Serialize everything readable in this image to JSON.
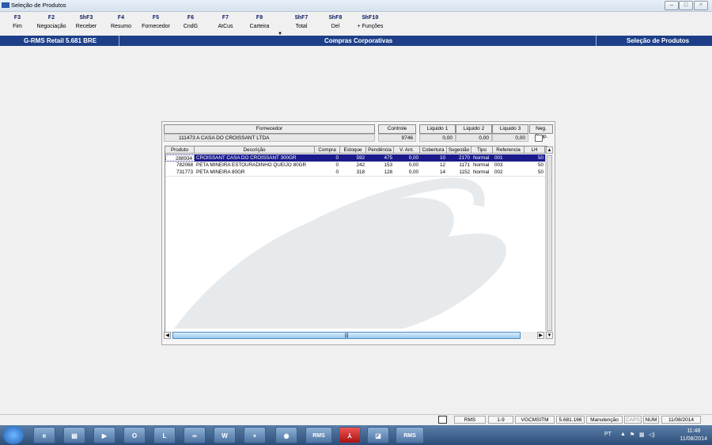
{
  "window": {
    "title": "Seleção de Produtos"
  },
  "fkeys": [
    {
      "key": "F3",
      "label": "Fim"
    },
    {
      "key": "F2",
      "label": "Negociação"
    },
    {
      "key": "ShF3",
      "label": "Receber"
    },
    {
      "key": "F4",
      "label": "Resumo"
    },
    {
      "key": "F5",
      "label": "Fornecedor"
    },
    {
      "key": "F6",
      "label": "CndG"
    },
    {
      "key": "F7",
      "label": "AtCus"
    },
    {
      "key": "F9",
      "label": "Carteira"
    },
    {
      "key": "ShF7",
      "label": "Total"
    },
    {
      "key": "ShF8",
      "label": "Del"
    },
    {
      "key": "ShF10",
      "label": "+ Funções"
    }
  ],
  "header": {
    "left": "G-RMS Retail 5.681 BRE",
    "center": "Compras Corporativas",
    "right": "Seleção de Produtos"
  },
  "supplier": {
    "fornecedor_label": "Fornecedor",
    "fornecedor_value": "111473  A CASA DO CROISSANT LTDA",
    "controle_label": "Controle",
    "controle_value": "9746",
    "liquido1_label": "Liquido 1",
    "liquido1_value": "0,00",
    "liquido2_label": "Liquido 2",
    "liquido2_value": "0,00",
    "liquido3_label": "Liquido 3",
    "liquido3_value": "0,00",
    "neg_simp_label": "Neg. Simp."
  },
  "grid": {
    "columns": [
      "Produto",
      "Descrição",
      "Compra",
      "Estoque",
      "Pendência",
      "V. Ant.",
      "Cobertura",
      "Sugestão",
      "Tipo",
      "Referencia",
      "LH"
    ],
    "rows": [
      [
        "288934",
        "CROISSANT CASA DO CROISSANT 300GR",
        "0",
        "592",
        "475",
        "0,00",
        "10",
        "2170",
        "Normal",
        "001",
        "50"
      ],
      [
        "782068",
        "PETA MINEIRA ESTOURADINHO QUEIJO 80GR",
        "0",
        "242",
        "153",
        "0,00",
        "12",
        "1171",
        "Normal",
        "003",
        "50"
      ],
      [
        "731773",
        "PETA MINEIRA 80GR",
        "0",
        "318",
        "128",
        "0,00",
        "14",
        "1152",
        "Normal",
        "002",
        "50"
      ]
    ]
  },
  "statusbar": {
    "app": "RMS",
    "range": "1-9",
    "user": "VGCMSITM",
    "version": "5.681.166",
    "mode": "Manutenção",
    "caps": "CAPS",
    "num": "NUM",
    "date": "11/08/2014"
  },
  "taskbar": {
    "lang": "PT",
    "time": "11:48",
    "date": "11/08/2014",
    "app_labels": [
      "RMS",
      "RMS"
    ]
  }
}
